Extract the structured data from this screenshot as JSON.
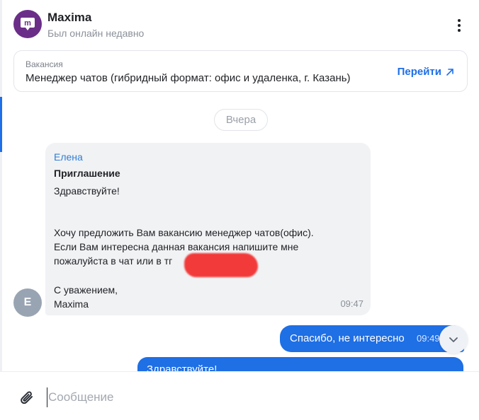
{
  "header": {
    "title": "Maxima",
    "status": "Был онлайн недавно",
    "logo_letter": "m",
    "menu_icon": "more-vertical-icon"
  },
  "vacancy": {
    "label": "Вакансия",
    "title": "Менеджер чатов (гибридный формат: офис и удаленка, г. Казань)",
    "link_label": "Перейти",
    "link_icon": "arrow-up-right-icon"
  },
  "date_divider": "Вчера",
  "incoming_message": {
    "avatar_letter": "Е",
    "sender": "Елена",
    "title": "Приглашение",
    "greeting": "Здравствуйте!",
    "line1": "Хочу предложить Вам вакансию менеджер чатов(офис).",
    "line2": "Если Вам интересна данная вакансия напишите мне",
    "line3": "пожалуйста в чат или в тг",
    "closing": "С уважением,",
    "signature": "Maxima",
    "time": "09:47"
  },
  "outgoing_messages": [
    {
      "text": "Спасибо, не интересно",
      "time": "09:49"
    },
    {
      "text": "Здравствуйте!"
    }
  ],
  "composer": {
    "placeholder": "Сообщение",
    "attach_icon": "paperclip-icon"
  },
  "scroll_icon": "chevron-down-icon",
  "colors": {
    "accent": "#1e6fe8",
    "outgoing_bubble": "#1f6fe5",
    "incoming_bubble": "#f1f2f4",
    "logo_bg": "#6a2e88",
    "sender_name": "#2f7ed6",
    "redaction": "#f23a3a"
  }
}
